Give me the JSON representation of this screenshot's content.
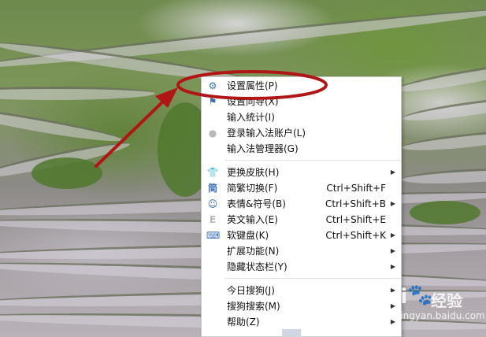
{
  "menu": {
    "groups": [
      [
        {
          "icon": "gear-icon",
          "glyph": "⚙",
          "label": "设置属性(P)"
        },
        {
          "icon": "flag-icon",
          "glyph": "⚑",
          "label": "设置向导(X)"
        },
        {
          "icon": "",
          "glyph": "",
          "label": "输入统计(I)"
        },
        {
          "icon": "user-icon",
          "glyph": "●",
          "label": "登录输入法账户(L)"
        },
        {
          "icon": "",
          "glyph": "",
          "label": "输入法管理器(G)"
        }
      ],
      [
        {
          "icon": "tshirt-icon",
          "glyph": "👕",
          "label": "更换皮肤(H)",
          "arrow": true
        },
        {
          "icon": "simplified-icon",
          "glyph": "简",
          "label": "简繁切换(F)",
          "shortcut": "Ctrl+Shift+F"
        },
        {
          "icon": "smiley-icon",
          "glyph": "☺",
          "label": "表情&符号(B)",
          "shortcut": "Ctrl+Shift+B",
          "arrow": true
        },
        {
          "icon": "letter-e-icon",
          "glyph": "E",
          "label": "英文输入(E)",
          "shortcut": "Ctrl+Shift+E"
        },
        {
          "icon": "keyboard-icon",
          "glyph": "⌨",
          "label": "软键盘(K)",
          "shortcut": "Ctrl+Shift+K",
          "arrow": true
        },
        {
          "icon": "",
          "glyph": "",
          "label": "扩展功能(N)",
          "arrow": true
        },
        {
          "icon": "",
          "glyph": "",
          "label": "隐藏状态栏(Y)",
          "arrow": true
        }
      ],
      [
        {
          "icon": "",
          "glyph": "",
          "label": "今日搜狗(J)",
          "arrow": true
        },
        {
          "icon": "",
          "glyph": "",
          "label": "搜狗搜索(M)",
          "arrow": true
        },
        {
          "icon": "",
          "glyph": "",
          "label": "帮助(Z)",
          "arrow": true
        }
      ]
    ]
  },
  "watermark": {
    "brand": "Bai",
    "paw": "🐾",
    "name": "经验",
    "url": "jingyan.baidu.com"
  },
  "colors": {
    "annotation": "#b01616",
    "menu_bg": "#ffffff",
    "icon_blue": "#3a6fb7"
  }
}
